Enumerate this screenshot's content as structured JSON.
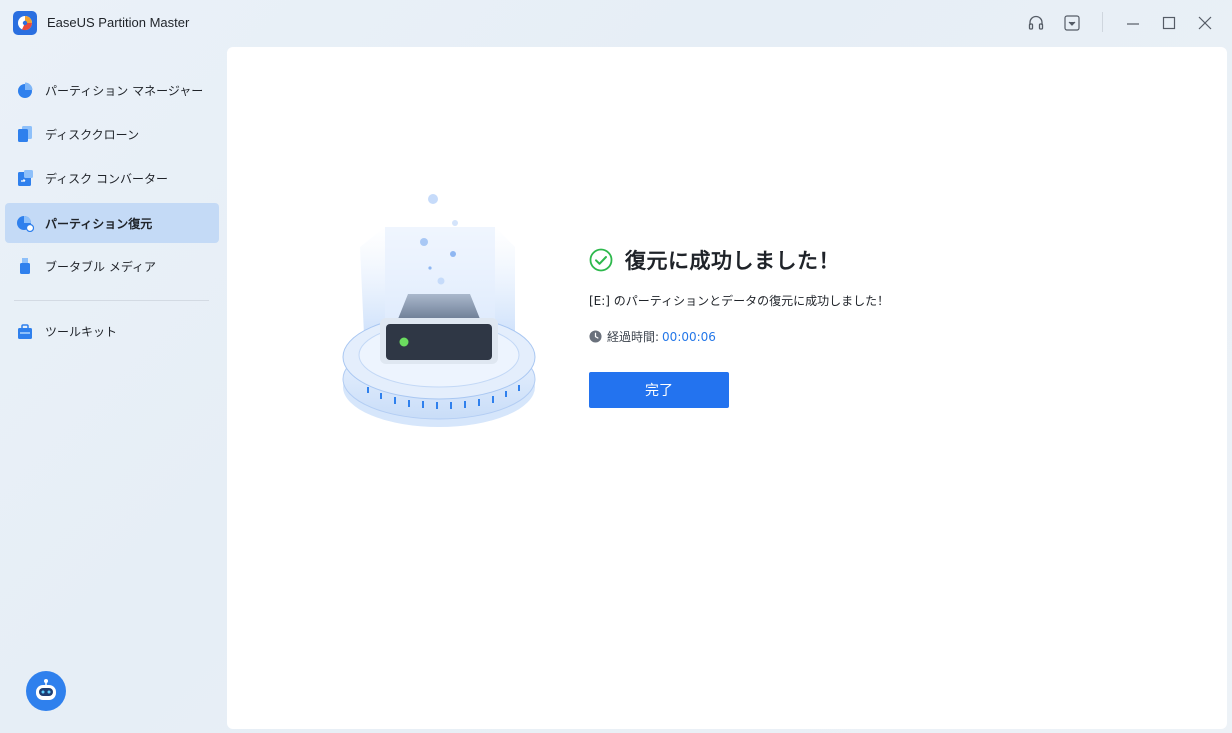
{
  "app": {
    "title": "EaseUS Partition Master"
  },
  "titlebar_icons": [
    "headset-icon",
    "dropdown-menu-icon",
    "minimize-icon",
    "maximize-icon",
    "close-icon"
  ],
  "sidebar": {
    "items": [
      {
        "label": "パーティション マネージャー",
        "icon": "pie-chart-icon",
        "active": false
      },
      {
        "label": "ディスククローン",
        "icon": "disk-clone-icon",
        "active": false
      },
      {
        "label": "ディスク コンバーター",
        "icon": "disk-converter-icon",
        "active": false
      },
      {
        "label": "パーティション復元",
        "icon": "partition-recovery-icon",
        "active": true
      },
      {
        "label": "ブータブル メディア",
        "icon": "usb-drive-icon",
        "active": false
      },
      {
        "label": "ツールキット",
        "icon": "toolkit-icon",
        "active": false
      }
    ]
  },
  "result": {
    "title": "復元に成功しました！",
    "message": "[E:] のパーティションとデータの復元に成功しました！",
    "elapsed_label": "経過時間:",
    "elapsed_value": "00:00:06",
    "done_label": "完了"
  },
  "colors": {
    "accent": "#2373EF",
    "success": "#2DB84C",
    "active_nav": "#C4DAF6",
    "elapsed_value": "#2477E8"
  }
}
